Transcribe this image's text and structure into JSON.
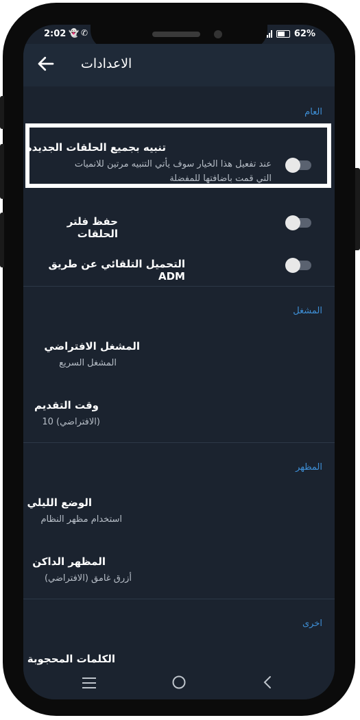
{
  "status_bar": {
    "time": "2:02",
    "battery": "62%"
  },
  "app_bar": {
    "title": "الاعدادات"
  },
  "sections": {
    "general": {
      "header": "العام",
      "notify_all": {
        "label": "تنبيه بجميع الحلقات الجديدة",
        "sub1": "عند تفعيل هذا الخيار سوف يأتي التنبيه مرتين للانميات",
        "sub2": "التي قمت باضافتها للمفضلة"
      },
      "save_filter": {
        "label": "حفظ فلتر الحلقات"
      },
      "adm": {
        "label": "التحميل التلقائي عن طريق ADM"
      }
    },
    "player": {
      "header": "المشغل",
      "default_player": {
        "label": "المشغل الافتراضي",
        "sub": "المشغل السريع"
      },
      "seek_time": {
        "label": "وقت التقديم",
        "sub": "(الافتراضي) 10"
      }
    },
    "appearance": {
      "header": "المظهر",
      "night_mode": {
        "label": "الوضع الليلي",
        "sub": "استخدام مظهر النظام"
      },
      "dark_theme": {
        "label": "المظهر الداكن",
        "sub": "أزرق غامق (الافتراضي)"
      }
    },
    "other": {
      "header": "اخرى",
      "blocked_words": {
        "label": "الكلمات المحجوبة"
      }
    }
  },
  "colors": {
    "accent": "#3e8fd6",
    "background": "#1b232f",
    "appbar": "#1f2a38"
  }
}
